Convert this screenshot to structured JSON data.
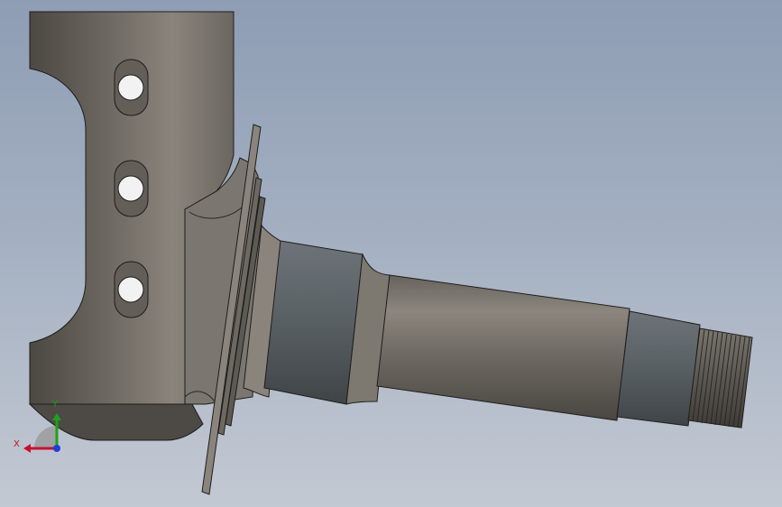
{
  "triad": {
    "x_label": "X",
    "y_label": "Y",
    "x_color": "#c8102e",
    "y_color": "#1aa31a",
    "z_color": "#1f3fd6"
  },
  "model": {
    "part_color": "#76716b",
    "background_top": "#8e9db4",
    "background_bottom": "#c3c9d3"
  }
}
